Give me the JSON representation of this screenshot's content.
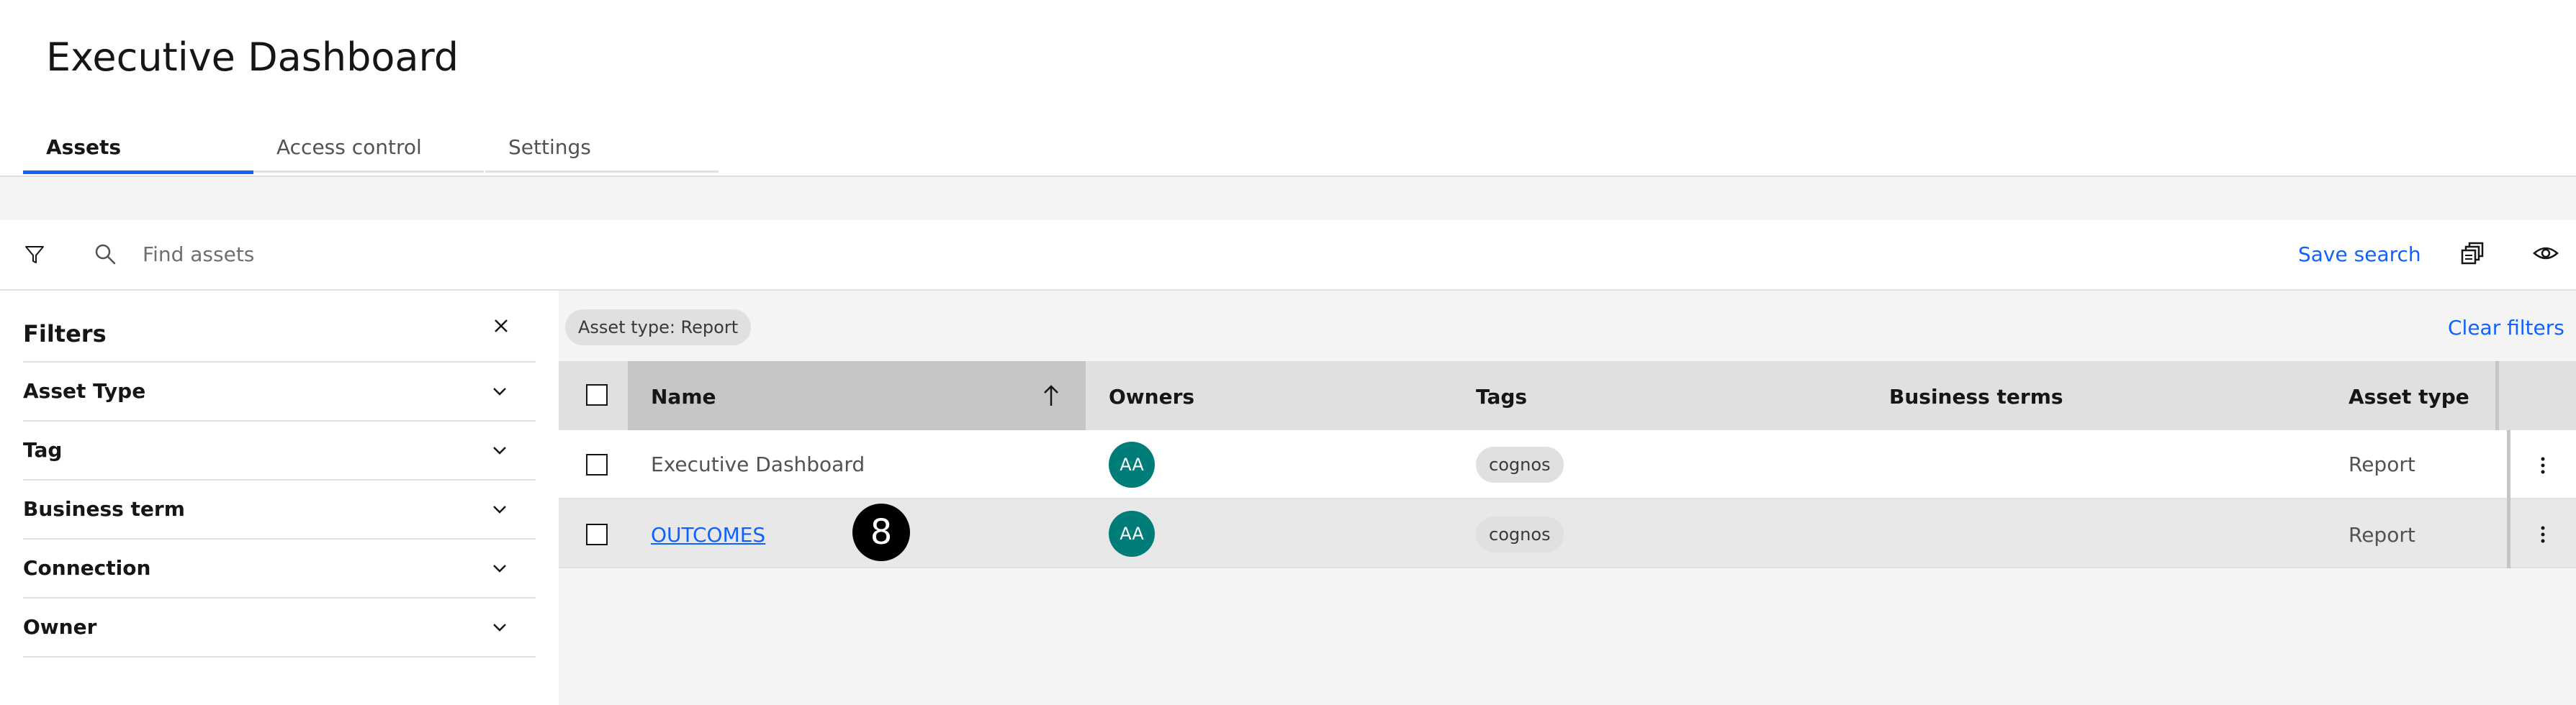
{
  "header": {
    "title": "Executive Dashboard"
  },
  "tabs": [
    {
      "label": "Assets",
      "active": true
    },
    {
      "label": "Access control",
      "active": false
    },
    {
      "label": "Settings",
      "active": false
    }
  ],
  "toolbar": {
    "search_placeholder": "Find assets",
    "save_search_label": "Save search",
    "icons": [
      "filter-icon",
      "search-icon",
      "bulk-copy-icon",
      "view-icon"
    ]
  },
  "filters": {
    "title": "Filters",
    "items": [
      {
        "label": "Asset Type"
      },
      {
        "label": "Tag"
      },
      {
        "label": "Business term"
      },
      {
        "label": "Connection"
      },
      {
        "label": "Owner"
      }
    ]
  },
  "applied_filter_chip": "Asset type: Report",
  "clear_filters_label": "Clear filters",
  "table": {
    "columns": [
      "Name",
      "Owners",
      "Tags",
      "Business terms",
      "Asset type"
    ],
    "sorted_by": "Name",
    "rows": [
      {
        "name": "Executive Dashboard",
        "owner_initials": "AA",
        "tag": "cognos",
        "business_terms": "",
        "asset_type": "Report",
        "is_link": false
      },
      {
        "name": "OUTCOMES",
        "owner_initials": "AA",
        "tag": "cognos",
        "business_terms": "",
        "asset_type": "Report",
        "is_link": true
      }
    ]
  },
  "step_badge": "8",
  "colors": {
    "accent": "#0f62fe",
    "avatar": "#007d79",
    "text": "#161616",
    "muted_text": "#525252",
    "header_bg": "#e0e0e0",
    "sorted_header_bg": "#c6c6c6"
  }
}
